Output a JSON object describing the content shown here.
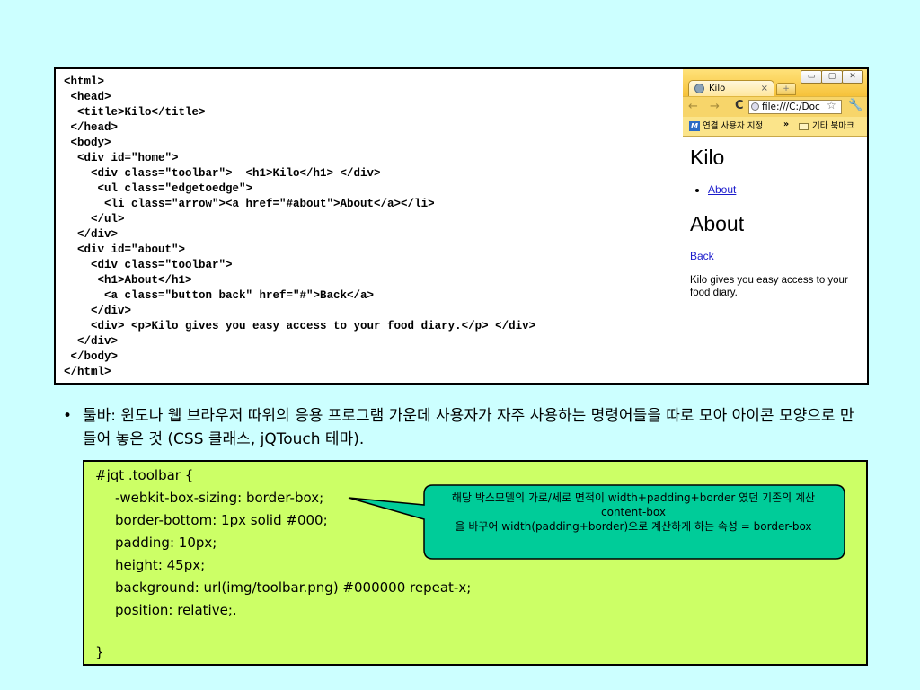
{
  "code": {
    "lines": [
      "<html>",
      " <head>",
      "  <title>Kilo</title>",
      " </head>",
      " <body>",
      "  <div id=\"home\">",
      "    <div class=\"toolbar\">  <h1>Kilo</h1> </div>",
      "     <ul class=\"edgetoedge\">",
      "      <li class=\"arrow\"><a href=\"#about\">About</a></li>",
      "    </ul>",
      "  </div>",
      "  <div id=\"about\">",
      "    <div class=\"toolbar\">",
      "     <h1>About</h1>",
      "      <a class=\"button back\" href=\"#\">Back</a>",
      "    </div>",
      "    <div> <p>Kilo gives you easy access to your food diary.</p> </div>",
      "  </div>",
      " </body>",
      "</html>"
    ]
  },
  "browser": {
    "tab_title": "Kilo",
    "tab_close": "×",
    "url": "file:///C:/Doc",
    "bookmark_1": "연결 사용자 지정",
    "bookmark_more": "»",
    "bookmark_other": "기타 북마크",
    "page": {
      "h1_home": "Kilo",
      "link_about": "About",
      "h1_about": "About",
      "link_back": "Back",
      "text": "Kilo gives you easy access to your food diary."
    }
  },
  "bullet": {
    "dot": "•",
    "text": "툴바: 윈도나 웹 브라우저 따위의 응용 프로그램 가운데 사용자가 자주 사용하는 명령어들을 따로 모아 아이콘 모양으로 만들어 놓은 것 (CSS 클래스, jQTouch 테마)."
  },
  "css_code": {
    "lines": [
      "#jqt .toolbar {",
      "-webkit-box-sizing: border-box;",
      "border-bottom: 1px solid #000;",
      "padding: 10px;",
      "height: 45px;",
      "background: url(img/toolbar.png) #000000 repeat-x;",
      "position: relative;.",
      "}"
    ]
  },
  "callout": {
    "line1": "해당 박스모델의 가로/세로 면적이 width+padding+border 였던 기존의 계산 content-box",
    "line2": "을 바꾸어 width(padding+border)으로 계산하게 하는 속성 = border-box"
  },
  "colors": {
    "background": "#ccffff",
    "css_box": "#ccff66",
    "callout": "#00cc99"
  }
}
